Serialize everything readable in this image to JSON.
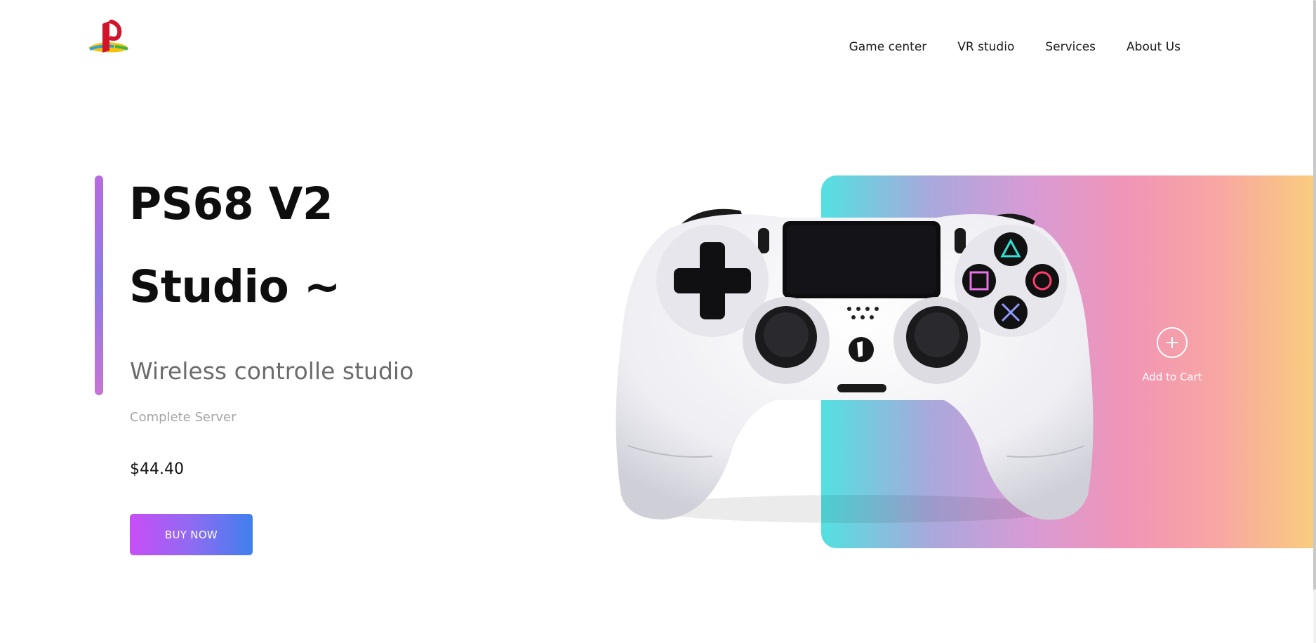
{
  "header": {
    "logo_icon": "playstation-logo-icon",
    "nav": [
      {
        "label": "Game center"
      },
      {
        "label": "VR studio"
      },
      {
        "label": "Services"
      },
      {
        "label": "About Us"
      }
    ]
  },
  "hero": {
    "title_line1": "PS68 V2",
    "title_line2": "Studio ~",
    "subtitle": "Wireless controlle studio",
    "tagline": "Complete Server",
    "price": "$44.40",
    "buy_label": "BUY NOW"
  },
  "product": {
    "image_icon": "gamepad-controller-icon",
    "cart_icon": "plus-circle-icon",
    "cart_label": "Add to Cart"
  },
  "colors": {
    "buy_gradient": [
      "#c84ef7",
      "#3f80ee"
    ],
    "panel_gradient": [
      "#52e1e0",
      "#d79bd5",
      "#f195b6",
      "#f9cd7d"
    ]
  }
}
